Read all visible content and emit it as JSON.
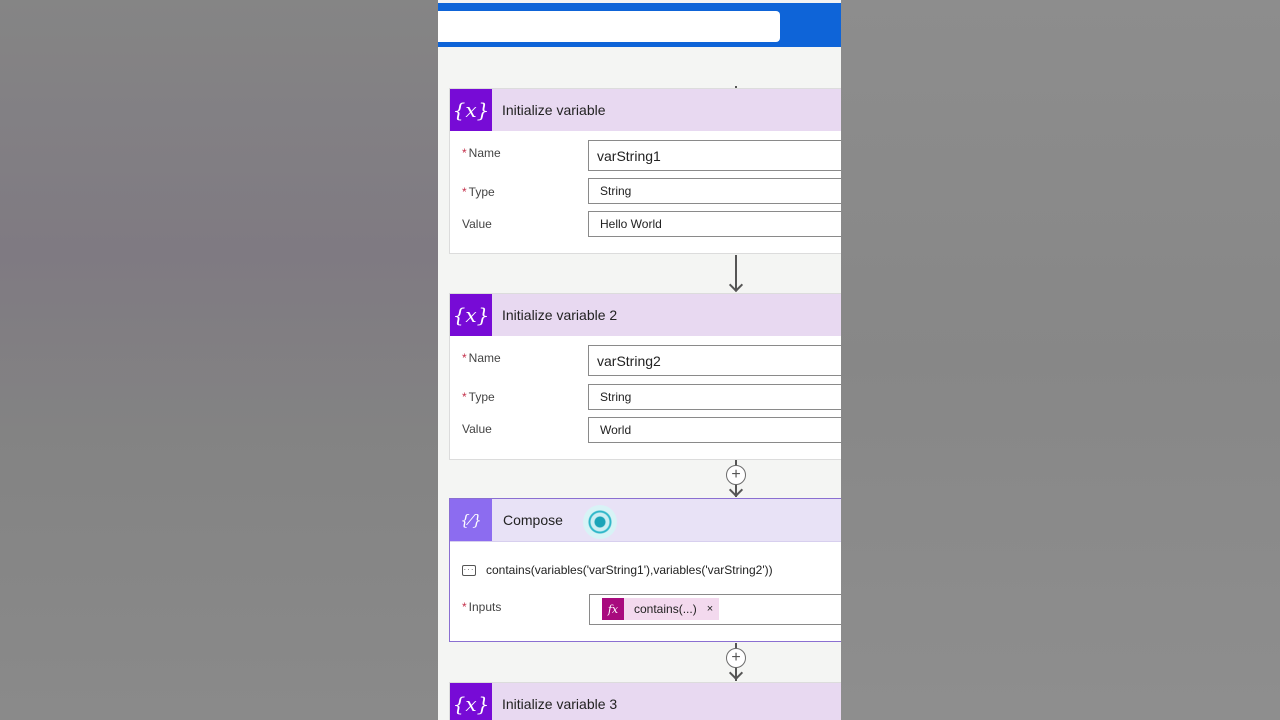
{
  "cards": [
    {
      "title": "Initialize variable",
      "name_label": "Name",
      "type_label": "Type",
      "value_label": "Value",
      "name_value": "varString1",
      "type_value": "String",
      "value_value": "Hello World"
    },
    {
      "title": "Initialize variable 2",
      "name_label": "Name",
      "type_label": "Type",
      "value_label": "Value",
      "name_value": "varString2",
      "type_value": "String",
      "value_value": "World"
    }
  ],
  "compose": {
    "title": "Compose",
    "comment": "contains(variables('varString1'),variables('varString2'))",
    "inputs_label": "Inputs",
    "token_label": "contains(...)",
    "token_remove": "×",
    "token_icon": "fx"
  },
  "next_card": {
    "title": "Initialize variable 3"
  },
  "icons": {
    "variable_icon": "{x}",
    "compose_icon": "{⁄}",
    "required_mark": "*",
    "add_step": "+"
  },
  "colors": {
    "topbar": "#0e64d8",
    "variable_header": "#e8d9f1",
    "variable_icon_bg": "#770bd6",
    "compose_icon_bg": "#8c6cf0",
    "token_icon_bg": "#a80a7e"
  }
}
